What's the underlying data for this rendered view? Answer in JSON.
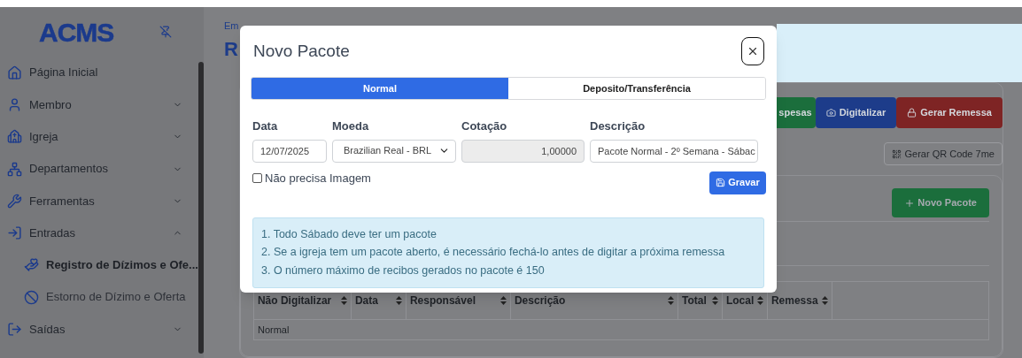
{
  "sidebar": {
    "logo": "ACMS",
    "items": [
      {
        "label": "Página Inicial",
        "kind": "link"
      },
      {
        "label": "Membro",
        "kind": "group",
        "expanded": false
      },
      {
        "label": "Igreja",
        "kind": "group",
        "expanded": false
      },
      {
        "label": "Departamentos",
        "kind": "group",
        "expanded": false
      },
      {
        "label": "Ferramentas",
        "kind": "group",
        "expanded": false
      },
      {
        "label": "Entradas",
        "kind": "group",
        "expanded": true,
        "children": [
          {
            "label": "Registro de Dízimos e Ofe...",
            "selected": true
          },
          {
            "label": "Estorno de Dízimo e Oferta",
            "selected": false
          }
        ]
      },
      {
        "label": "Saídas",
        "kind": "group",
        "expanded": false
      }
    ]
  },
  "page": {
    "breadcrumb": "Em",
    "title": "R",
    "actions": [
      {
        "label": "spesas",
        "kind": "success"
      },
      {
        "label": "Digitalizar",
        "kind": "primary"
      },
      {
        "label": "Gerar Remessa",
        "kind": "danger"
      }
    ],
    "qr_button": "Gerar QR Code 7me",
    "new_button": "Novo Pacote",
    "table": {
      "columns": [
        "Não Digitalizar",
        "Data",
        "Responsável",
        "Descrição",
        "Total",
        "Local",
        "Remessa"
      ],
      "rows": [
        {
          "section": "Normal"
        }
      ]
    }
  },
  "modal": {
    "title": "Novo Pacote",
    "tabs": [
      {
        "label": "Normal",
        "selected": true
      },
      {
        "label": "Deposito/Transferência",
        "selected": false
      }
    ],
    "fields": [
      {
        "label": "Data",
        "kind": "input",
        "value": "12/07/2025",
        "disabled": false
      },
      {
        "label": "Moeda",
        "kind": "select",
        "value": "Brazilian Real - BRL",
        "disabled": false
      },
      {
        "label": "Cotação",
        "kind": "input",
        "value": "1,00000",
        "disabled": true
      },
      {
        "label": "Descrição",
        "kind": "input",
        "value": "Pacote Normal - 2º Semana - Sábac",
        "disabled": false
      }
    ],
    "checkbox": {
      "label": "Não precisa Imagem",
      "checked": false
    },
    "save_button": "Gravar",
    "notes": [
      "1. Todo Sábado deve ter um pacote",
      "2. Se a igreja tem um pacote aberto, é necessário fechá-lo antes de digitar a próxima remessa",
      "3. O número máximo de recibos gerados no pacote é 150"
    ]
  }
}
